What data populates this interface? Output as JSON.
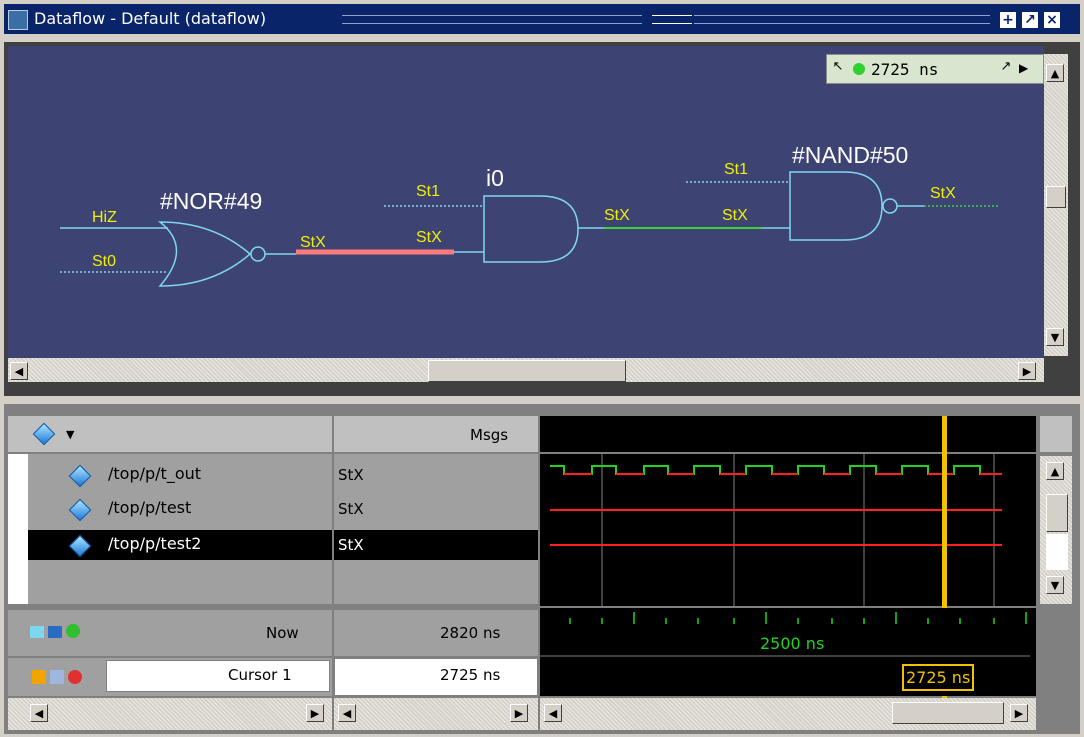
{
  "window": {
    "title": "Dataflow - Default (dataflow)",
    "buttons": {
      "dock": "+",
      "undock": "↗",
      "close": "×"
    }
  },
  "timecontrol": {
    "value": "2725 ns",
    "status_color": "#2fd02f"
  },
  "dataflow": {
    "gates": {
      "nor": {
        "label": "#NOR#49",
        "inputs": [
          "HiZ",
          "St0"
        ],
        "output": "StX"
      },
      "and": {
        "label": "i0",
        "inputs": [
          "St1",
          "StX"
        ],
        "output": "StX"
      },
      "nand": {
        "label": "#NAND#50",
        "inputs": [
          "St1",
          "StX"
        ],
        "output": "StX"
      }
    },
    "colors": {
      "background": "#3d4373",
      "gate": "#7fd6f0",
      "label": "#f0f000",
      "net_highlight": "#ff7a7a",
      "net_active": "#3dd33d"
    }
  },
  "wave": {
    "msgs_header": "Msgs",
    "signals": [
      {
        "name": "/top/p/t_out",
        "value": "StX"
      },
      {
        "name": "/top/p/test",
        "value": "StX"
      },
      {
        "name": "/top/p/test2",
        "value": "StX"
      }
    ],
    "now_label": "Now",
    "now_value": "2820 ns",
    "cursor_label": "Cursor 1",
    "cursor_value": "2725 ns",
    "timeline_label": "2500 ns",
    "cursor_tag": "2725 ns",
    "colors": {
      "wave_green": "#21d321",
      "wave_red": "#ff2020",
      "cursor": "#f2c100"
    }
  }
}
